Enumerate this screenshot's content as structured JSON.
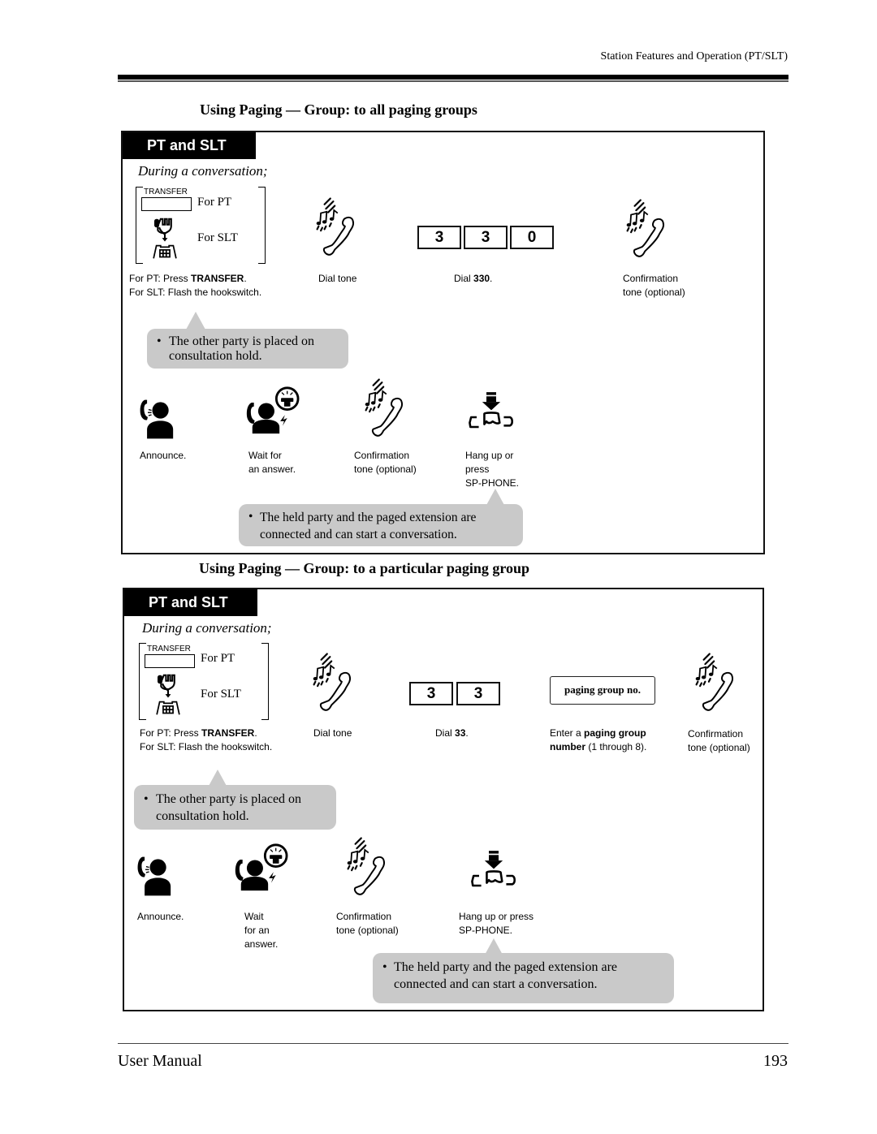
{
  "header": {
    "running_head": "Station Features and Operation (PT/SLT)"
  },
  "sections": [
    {
      "title": "Using Paging — Group: to all paging groups",
      "tab": "PT and SLT",
      "during": "During a conversation;",
      "transfer_key_label": "TRANSFER",
      "for_pt": "For PT",
      "for_slt": "For SLT",
      "step1_caption_line1_prefix": "For PT: Press ",
      "step1_caption_line1_bold": "TRANSFER",
      "step1_caption_line1_suffix": ".",
      "step1_caption_line2": "For SLT: Flash the hookswitch.",
      "dial_tone": "Dial tone",
      "digits": [
        "3",
        "3",
        "0"
      ],
      "dial_caption_prefix": "Dial ",
      "dial_caption_bold": "330",
      "dial_caption_suffix": ".",
      "confirm_line1": "Confirmation",
      "confirm_line2": "tone (optional)",
      "bubble1_line1": "The other party is placed on",
      "bubble1_line2": "consultation hold.",
      "announce": "Announce.",
      "wait_lines": [
        "Wait for",
        "an answer."
      ],
      "confirm2_lines": [
        "Confirmation",
        "tone (optional)"
      ],
      "hangup_lines": [
        "Hang up or",
        "press",
        "SP-PHONE."
      ],
      "bubble2_line1": "The held party and the paged extension are",
      "bubble2_line2": "connected and can start a conversation."
    },
    {
      "title": "Using Paging — Group: to a particular paging group",
      "tab": "PT and SLT",
      "during": "During a conversation;",
      "transfer_key_label": "TRANSFER",
      "for_pt": "For PT",
      "for_slt": "For SLT",
      "step1_caption_line1_prefix": "For PT: Press ",
      "step1_caption_line1_bold": "TRANSFER",
      "step1_caption_line1_suffix": ".",
      "step1_caption_line2": "For SLT: Flash the hookswitch.",
      "dial_tone": "Dial tone",
      "digits": [
        "3",
        "3"
      ],
      "dial_caption_prefix": "Dial ",
      "dial_caption_bold": "33",
      "dial_caption_suffix": ".",
      "paging_group_box": "paging group no.",
      "pg_caption_prefix": "Enter a ",
      "pg_caption_bold1": "paging group",
      "pg_caption_bold2": "number",
      "pg_caption_suffix": " (1 through 8).",
      "confirm_line1": "Confirmation",
      "confirm_line2": "tone (optional)",
      "bubble1_line1": "The other party is placed on",
      "bubble1_line2": "consultation hold.",
      "announce": "Announce.",
      "wait_lines": [
        "Wait",
        "for an",
        "answer."
      ],
      "confirm2_lines": [
        "Confirmation",
        "tone (optional)"
      ],
      "hangup_lines": [
        "Hang up or press",
        "SP-PHONE."
      ],
      "bubble2_line1": "The held party and the paged extension are",
      "bubble2_line2": "connected and can start a conversation."
    }
  ],
  "footer": {
    "left": "User Manual",
    "page_number": "193"
  }
}
